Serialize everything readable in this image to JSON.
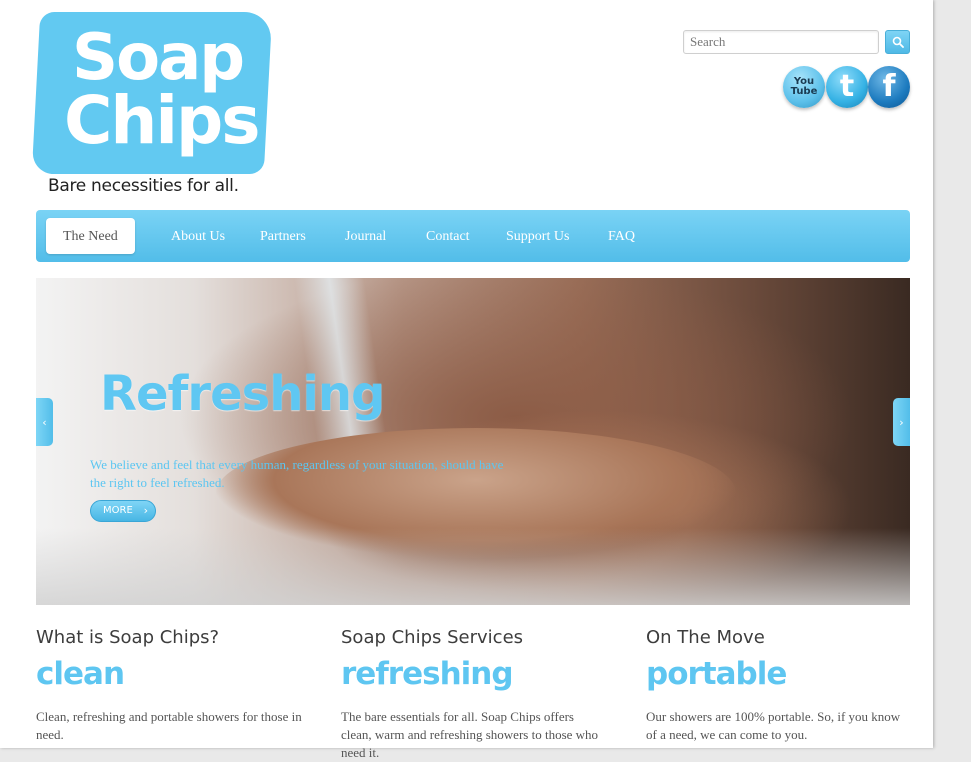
{
  "brand": {
    "logo_line1": "Soap",
    "logo_line2": "Chips",
    "tagline": "Bare necessities for all."
  },
  "search": {
    "placeholder": "Search",
    "button_icon": "search-icon"
  },
  "social": {
    "youtube_line1": "You",
    "youtube_line2": "Tube",
    "twitter_glyph": "t",
    "facebook_glyph": "f"
  },
  "nav": {
    "items": [
      {
        "label": "The Need",
        "active": true
      },
      {
        "label": "About Us"
      },
      {
        "label": "Partners"
      },
      {
        "label": "Journal"
      },
      {
        "label": "Contact"
      },
      {
        "label": "Support Us"
      },
      {
        "label": "FAQ"
      }
    ]
  },
  "hero": {
    "title": "Refreshing",
    "text": "We believe and feel that every human, regardless of your situation, should have the right to feel refreshed.",
    "more_label": "MORE",
    "more_arrow": "›",
    "prev_arrow": "‹",
    "next_arrow": "›"
  },
  "columns": [
    {
      "heading": "What is Soap Chips?",
      "big": "clean",
      "text": "Clean, refreshing and portable showers for those in need."
    },
    {
      "heading": "Soap Chips Services",
      "big": "refreshing",
      "text": "The bare essentials for all. Soap Chips offers clean, warm and refreshing showers to those who need it."
    },
    {
      "heading": "On The Move",
      "big": "portable",
      "text": "Our showers are 100% portable. So, if you know of a need, we can come to you."
    }
  ],
  "colors": {
    "accent": "#5ec6f1",
    "nav_gradient_top": "#7ad3f5",
    "nav_gradient_bottom": "#52bde9"
  }
}
